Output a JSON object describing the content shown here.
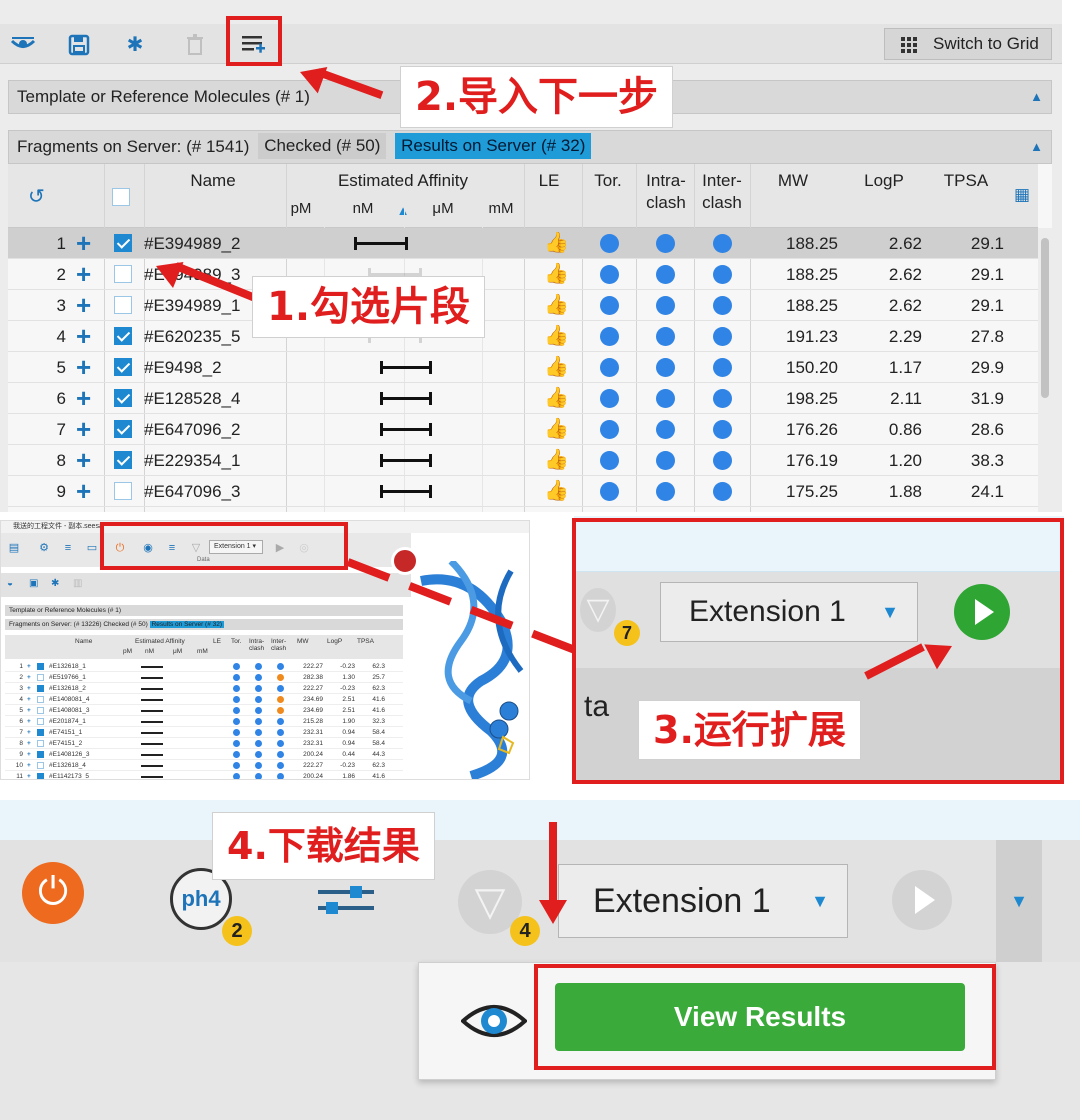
{
  "panel1": {
    "switch_label": "Switch to Grid",
    "template_bar": "Template or Reference Molecules (# 1)",
    "fragments_label": "Fragments on Server: (# 1541)",
    "checked_chip": "Checked (# 50)",
    "results_chip": "Results on Server (# 32)",
    "columns": {
      "name": "Name",
      "affinity": "Estimated Affinity",
      "pm": "pM",
      "nm": "nM",
      "um": "μM",
      "mm": "mM",
      "le": "LE",
      "tor": "Tor.",
      "intra": "Intra-",
      "intra2": "clash",
      "inter": "Inter-",
      "inter2": "clash",
      "mw": "MW",
      "logp": "LogP",
      "tpsa": "TPSA"
    },
    "rows": [
      {
        "num": "1",
        "checked": true,
        "name": "#E394989_2",
        "mw": "188.25",
        "logp": "2.62",
        "tpsa": "29.1"
      },
      {
        "num": "2",
        "checked": false,
        "name": "#E394989_3",
        "mw": "188.25",
        "logp": "2.62",
        "tpsa": "29.1"
      },
      {
        "num": "3",
        "checked": false,
        "name": "#E394989_1",
        "mw": "188.25",
        "logp": "2.62",
        "tpsa": "29.1"
      },
      {
        "num": "4",
        "checked": true,
        "name": "#E620235_5",
        "mw": "191.23",
        "logp": "2.29",
        "tpsa": "27.8"
      },
      {
        "num": "5",
        "checked": true,
        "name": "#E9498_2",
        "mw": "150.20",
        "logp": "1.17",
        "tpsa": "29.9"
      },
      {
        "num": "6",
        "checked": true,
        "name": "#E128528_4",
        "mw": "198.25",
        "logp": "2.11",
        "tpsa": "31.9"
      },
      {
        "num": "7",
        "checked": true,
        "name": "#E647096_2",
        "mw": "176.26",
        "logp": "0.86",
        "tpsa": "28.6"
      },
      {
        "num": "8",
        "checked": true,
        "name": "#E229354_1",
        "mw": "176.19",
        "logp": "1.20",
        "tpsa": "38.3"
      },
      {
        "num": "9",
        "checked": false,
        "name": "#E647096_3",
        "mw": "175.25",
        "logp": "1.88",
        "tpsa": "24.1"
      }
    ]
  },
  "annotations": {
    "step1": "1.勾选片段",
    "step2": "2.导入下一步",
    "step3": "3.运行扩展",
    "step4": "4.下载结果"
  },
  "panel2": {
    "window_title": "我送的工程文件 - 副本.seesar",
    "extension": "Extension 1",
    "data_label": "Data",
    "template_bar": "Template or Reference Molecules (# 1)",
    "fragments_label": "Fragments on Server: (# 13226)",
    "checked_chip": "Checked (# 50)",
    "results_chip": "Results on Server (# 32)",
    "columns": {
      "name": "Name",
      "affinity": "Estimated Affinity",
      "le": "LE",
      "tor": "Tor.",
      "intra": "Intra- clash",
      "inter": "Inter- clash",
      "mw": "MW",
      "logp": "LogP",
      "tpsa": "TPSA",
      "pm": "pM",
      "nm": "nM",
      "um": "μM",
      "mm": "mM"
    },
    "rows": [
      {
        "num": "1",
        "checked": true,
        "name": "#E132618_1",
        "mw": "222.27",
        "logp": "-0.23",
        "tpsa": "62.3",
        "inter": "b"
      },
      {
        "num": "2",
        "checked": false,
        "name": "#E519766_1",
        "mw": "282.38",
        "logp": "1.30",
        "tpsa": "25.7",
        "inter": "o"
      },
      {
        "num": "3",
        "checked": true,
        "name": "#E132618_2",
        "mw": "222.27",
        "logp": "-0.23",
        "tpsa": "62.3",
        "inter": "b"
      },
      {
        "num": "4",
        "checked": false,
        "name": "#E1408081_4",
        "mw": "234.69",
        "logp": "2.51",
        "tpsa": "41.6",
        "inter": "o"
      },
      {
        "num": "5",
        "checked": false,
        "name": "#E1408081_3",
        "mw": "234.69",
        "logp": "2.51",
        "tpsa": "41.6",
        "inter": "o"
      },
      {
        "num": "6",
        "checked": false,
        "name": "#E201874_1",
        "mw": "215.28",
        "logp": "1.90",
        "tpsa": "32.3",
        "inter": "b"
      },
      {
        "num": "7",
        "checked": true,
        "name": "#E74151_1",
        "mw": "232.31",
        "logp": "0.94",
        "tpsa": "58.4",
        "inter": "b"
      },
      {
        "num": "8",
        "checked": false,
        "name": "#E74151_2",
        "mw": "232.31",
        "logp": "0.94",
        "tpsa": "58.4",
        "inter": "b"
      },
      {
        "num": "9",
        "checked": true,
        "name": "#E1408126_3",
        "mw": "200.24",
        "logp": "0.44",
        "tpsa": "44.3",
        "inter": "b"
      },
      {
        "num": "10",
        "checked": false,
        "name": "#E132618_4",
        "mw": "222.27",
        "logp": "-0.23",
        "tpsa": "62.3",
        "inter": "b"
      },
      {
        "num": "11",
        "checked": true,
        "name": "#E1142173_5",
        "mw": "200.24",
        "logp": "1.86",
        "tpsa": "41.6",
        "inter": "b"
      },
      {
        "num": "12",
        "checked": true,
        "name": "#E394989_2",
        "mw": "188.25",
        "logp": "2.62",
        "tpsa": "29.1",
        "inter": "b"
      }
    ]
  },
  "panel3": {
    "extension": "Extension 1",
    "badge": "7",
    "data_text": "ta"
  },
  "panel4": {
    "ph4": "ph4",
    "ph4_badge": "2",
    "filter_badge": "4",
    "extension": "Extension 1",
    "view_results": "View Results"
  },
  "colors": {
    "accent": "#1e88d0",
    "annotation": "#e01e1e",
    "run": "#2fa534",
    "view": "#3aaa3a",
    "power": "#ed6a1f"
  }
}
